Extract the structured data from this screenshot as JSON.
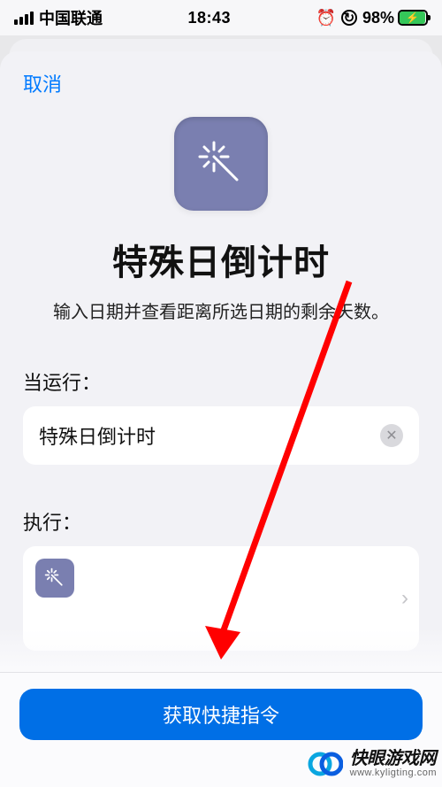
{
  "status_bar": {
    "carrier": "中国联通",
    "time": "18:43",
    "battery_pct": "98%"
  },
  "sheet": {
    "cancel_label": "取消",
    "title": "特殊日倒计时",
    "subtitle": "输入日期并查看距离所选日期的剩余天数。",
    "when_run_label": "当运行：",
    "name_value": "特殊日倒计时",
    "do_label": "执行：",
    "get_button_label": "获取快捷指令"
  },
  "watermark": {
    "line1": "快眼游戏网",
    "line2": "www.kyligting.com"
  },
  "colors": {
    "accent": "#007aff",
    "primary_button": "#006fe6",
    "icon_bg": "#7a7fb0",
    "arrow": "#ff0000",
    "battery_fill": "#35c759"
  }
}
